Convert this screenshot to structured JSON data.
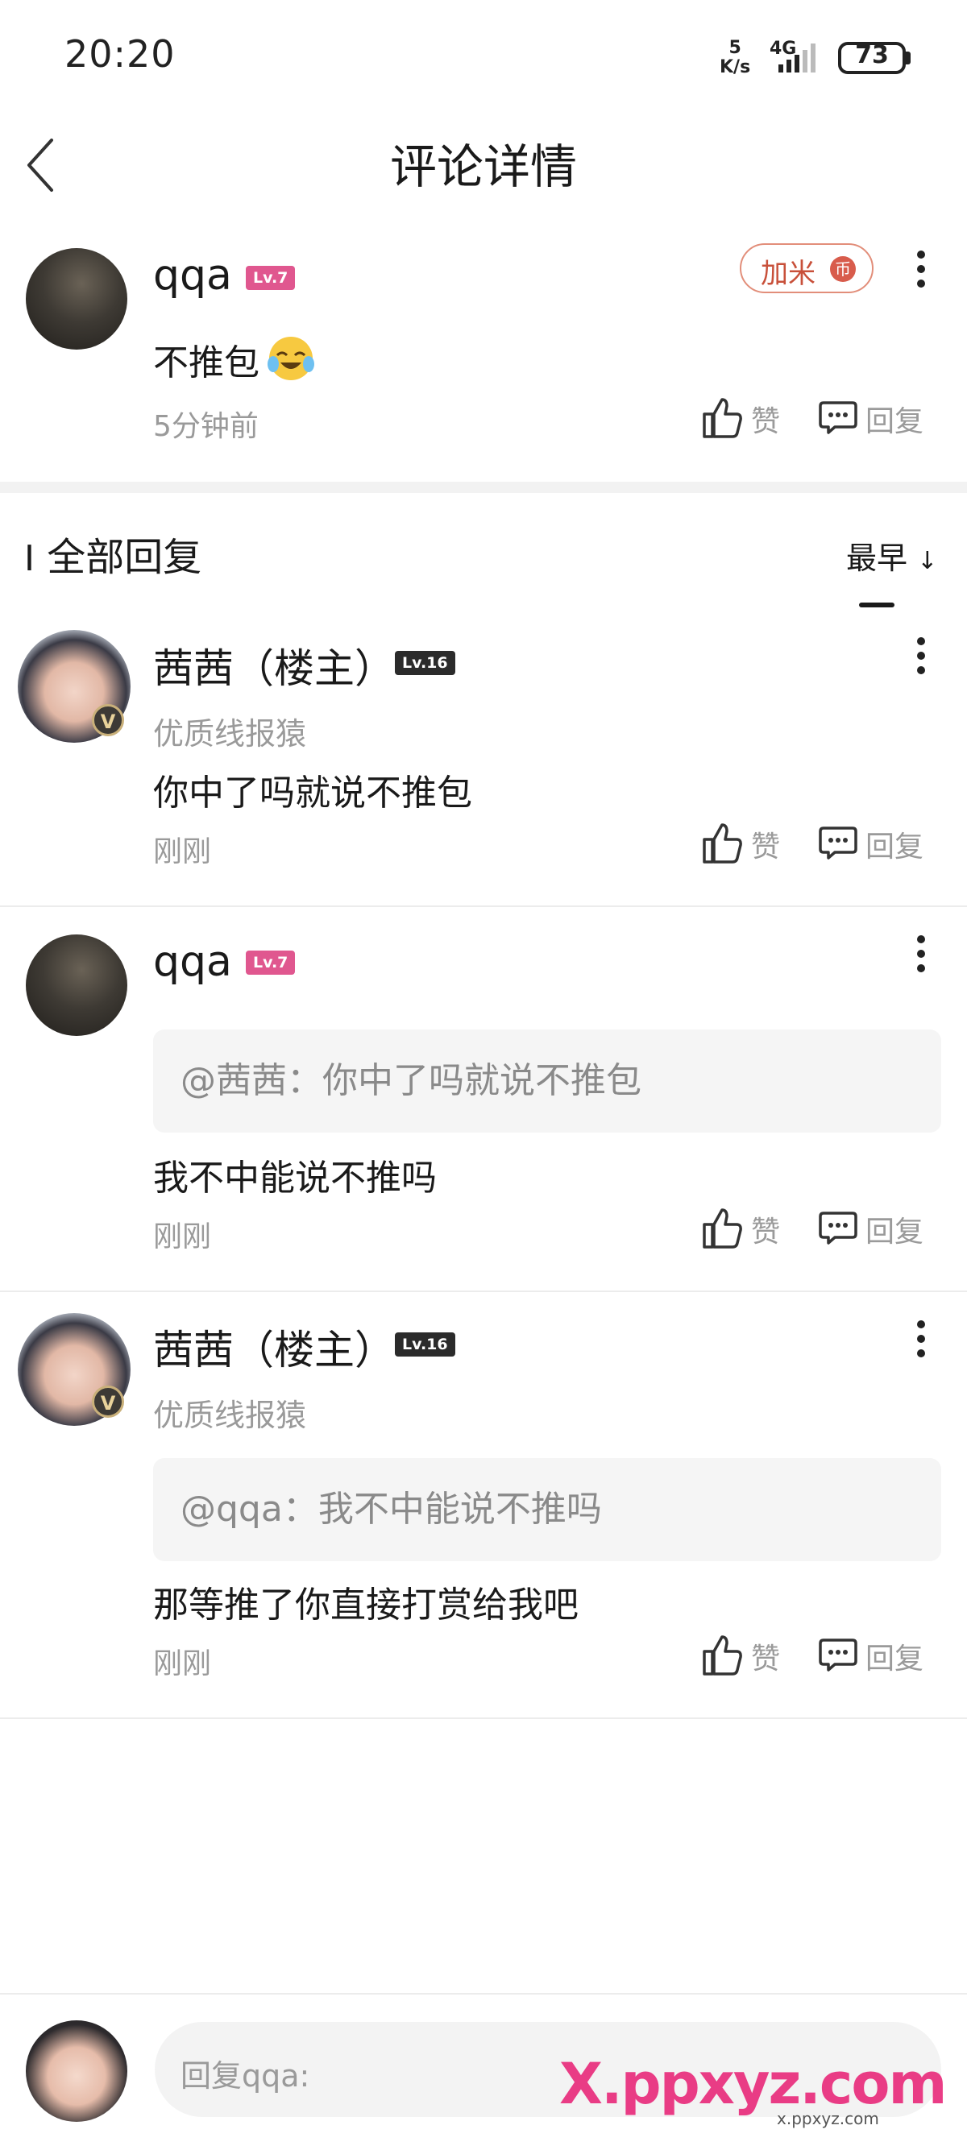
{
  "status_bar": {
    "time": "20:20",
    "net_speed_value": "5",
    "net_speed_unit": "K/s",
    "network": "4G",
    "battery": "73"
  },
  "header": {
    "title": "评论详情",
    "back_icon": "chevron-left-icon"
  },
  "main_comment": {
    "username": "qqa",
    "level": "Lv.7",
    "content": "不推包",
    "emoji": "crying-laughing-face",
    "time": "5分钟前",
    "jiami_label": "加米",
    "jiami_icon": "币",
    "like_label": "赞",
    "reply_label": "回复"
  },
  "replies_section": {
    "title": "全部回复",
    "sort_label": "最早"
  },
  "replies": [
    {
      "username": "茜茜（楼主）",
      "level": "Lv.16",
      "subtitle": "优质线报猿",
      "content": "你中了吗就说不推包",
      "time": "刚刚",
      "like_label": "赞",
      "reply_label": "回复",
      "verified": "V"
    },
    {
      "username": "qqa",
      "level": "Lv.7",
      "quote": "@茜茜：你中了吗就说不推包",
      "content": "我不中能说不推吗",
      "time": "刚刚",
      "like_label": "赞",
      "reply_label": "回复"
    },
    {
      "username": "茜茜（楼主）",
      "level": "Lv.16",
      "subtitle": "优质线报猿",
      "quote": "@qqa：我不中能说不推吗",
      "content": "那等推了你直接打赏给我吧",
      "time": "刚刚",
      "like_label": "赞",
      "reply_label": "回复",
      "verified": "V"
    }
  ],
  "bottom_bar": {
    "placeholder": "回复qqa:"
  },
  "watermark": {
    "text": "X.ppxyz.com",
    "small_text": "x.ppxyz.com"
  },
  "colors": {
    "level_pink": "#e0578f",
    "level_dark": "#2b2b2b",
    "jiami_red": "#c8503a",
    "watermark": "#e8297a"
  }
}
